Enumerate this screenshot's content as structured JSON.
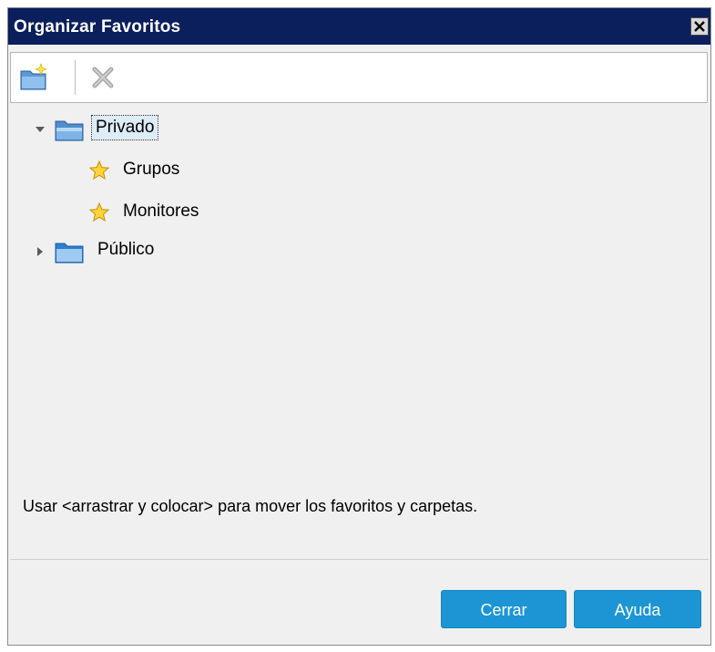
{
  "window": {
    "title": "Organizar Favoritos",
    "close_icon": "close-icon"
  },
  "toolbar": {
    "buttons": [
      {
        "icon": "new-folder-icon",
        "enabled": true
      },
      {
        "icon": "delete-icon",
        "enabled": false
      }
    ]
  },
  "tree": {
    "private": {
      "label": "Privado",
      "expanded": true,
      "selected": true,
      "children": [
        {
          "label": "Grupos",
          "icon": "star-icon"
        },
        {
          "label": "Monitores",
          "icon": "star-icon"
        }
      ]
    },
    "public": {
      "label": "Público",
      "expanded": false
    }
  },
  "hint": "Usar <arrastrar y colocar> para mover los favoritos y carpetas.",
  "footer": {
    "close_label": "Cerrar",
    "help_label": "Ayuda"
  },
  "colors": {
    "titlebar": "#0a1f5c",
    "button": "#1d95d4",
    "selection": "#dcecf8"
  }
}
